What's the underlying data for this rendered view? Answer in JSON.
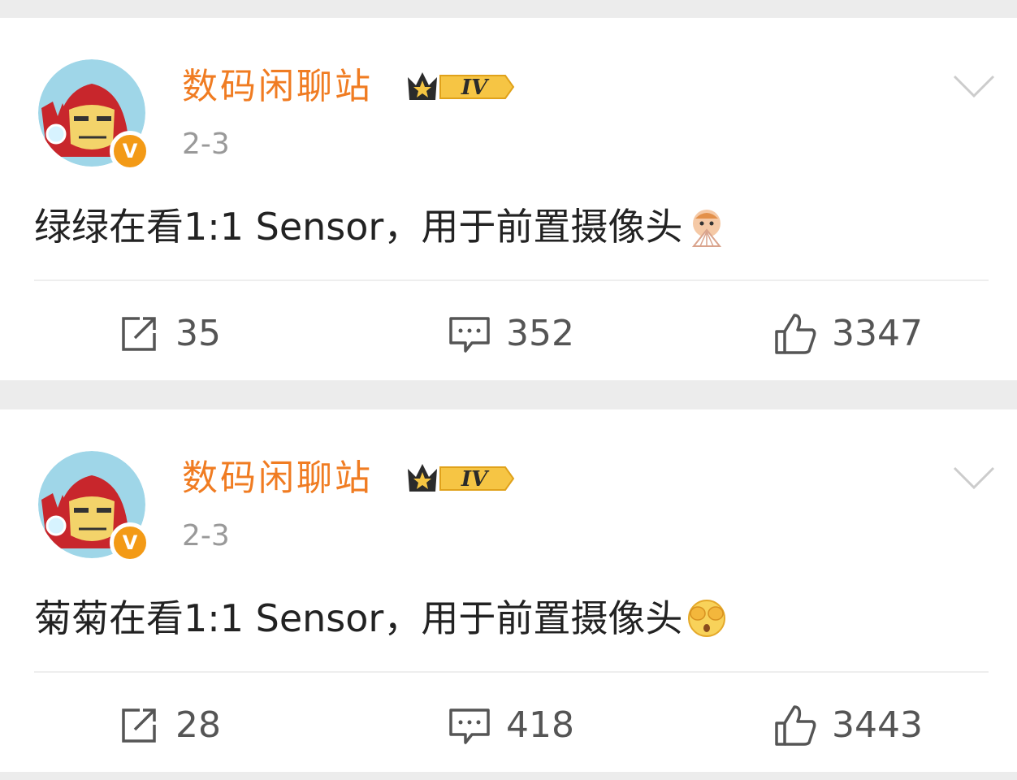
{
  "posts": [
    {
      "username": "数码闲聊站",
      "vip_level": "IV",
      "time": "2-3",
      "text": "绿绿在看1:1 Sensor，用于前置摄像头",
      "emoji": "fan-face-emoji",
      "reposts": "35",
      "comments": "352",
      "likes": "3347"
    },
    {
      "username": "数码闲聊站",
      "vip_level": "IV",
      "time": "2-3",
      "text": "菊菊在看1:1 Sensor，用于前置摄像头",
      "emoji": "cover-eyes-emoji",
      "reposts": "28",
      "comments": "418",
      "likes": "3443"
    }
  ],
  "colors": {
    "username": "#f07c22",
    "verified_badge": "#f39a16",
    "timestamp": "#999999",
    "text": "#222222",
    "background": "#ececec"
  },
  "icons": [
    "repost-icon",
    "comment-icon",
    "like-icon",
    "chevron-down-icon",
    "crown-icon",
    "verified-icon"
  ]
}
